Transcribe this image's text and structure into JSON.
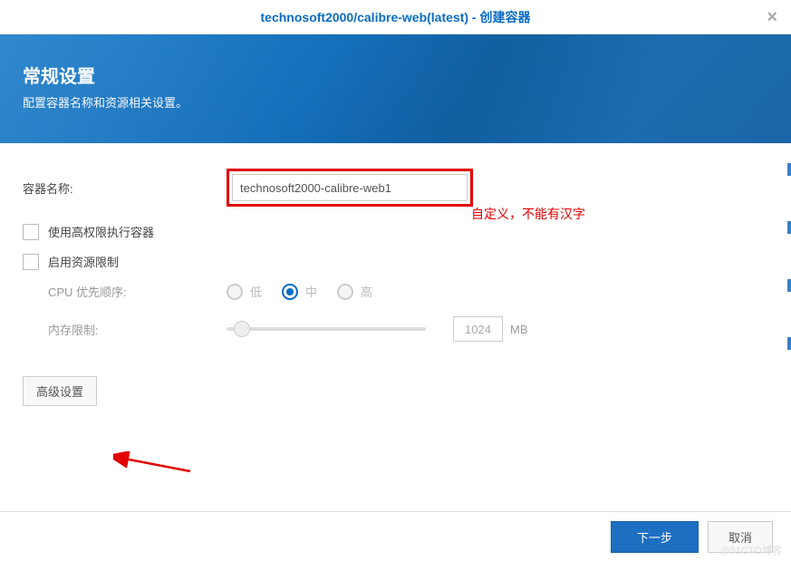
{
  "titlebar": {
    "text": "technosoft2000/calibre-web(latest) - 创建容器"
  },
  "banner": {
    "title": "常规设置",
    "subtitle": "配置容器名称和资源相关设置。"
  },
  "form": {
    "container_name_label": "容器名称:",
    "container_name_value": "technosoft2000-calibre-web1",
    "annotation": "自定义，不能有汉字",
    "checkbox_high_priv": "使用高权限执行容器",
    "checkbox_resource_limit": "启用资源限制",
    "cpu_priority_label": "CPU 优先顺序:",
    "cpu_options": {
      "low": "低",
      "mid": "中",
      "high": "高"
    },
    "mem_limit_label": "内存限制:",
    "mem_value": "1024",
    "mem_unit": "MB",
    "advanced_btn": "高级设置"
  },
  "footer": {
    "next": "下一步",
    "cancel": "取消"
  },
  "watermark": "@51CTO博客"
}
